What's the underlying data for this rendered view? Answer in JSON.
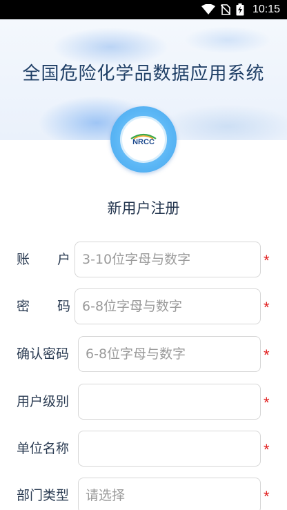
{
  "status_bar": {
    "time": "10:15",
    "icons": [
      "wifi-icon",
      "no-sim-icon",
      "battery-charging-icon"
    ]
  },
  "header": {
    "app_title": "全国危险化学品数据应用系统",
    "logo_text": "NRCC"
  },
  "page_title": "新用户注册",
  "form": {
    "account": {
      "label_chars": [
        "账",
        "户"
      ],
      "placeholder": "3-10位字母与数字",
      "required": "*"
    },
    "password": {
      "label_chars": [
        "密",
        "码"
      ],
      "placeholder": "6-8位字母与数字",
      "required": "*"
    },
    "confirm_password": {
      "label": "确认密码",
      "placeholder": "6-8位字母与数字",
      "required": "*"
    },
    "user_level": {
      "label": "用户级别",
      "value": "",
      "required": "*"
    },
    "unit_name": {
      "label": "单位名称",
      "value": "",
      "required": "*"
    },
    "department_type": {
      "label": "部门类型",
      "placeholder": "请选择",
      "required": "*"
    }
  },
  "colors": {
    "title": "#1f3f66",
    "required": "#e11b1b",
    "logo_ring": "#5ab6f5"
  }
}
